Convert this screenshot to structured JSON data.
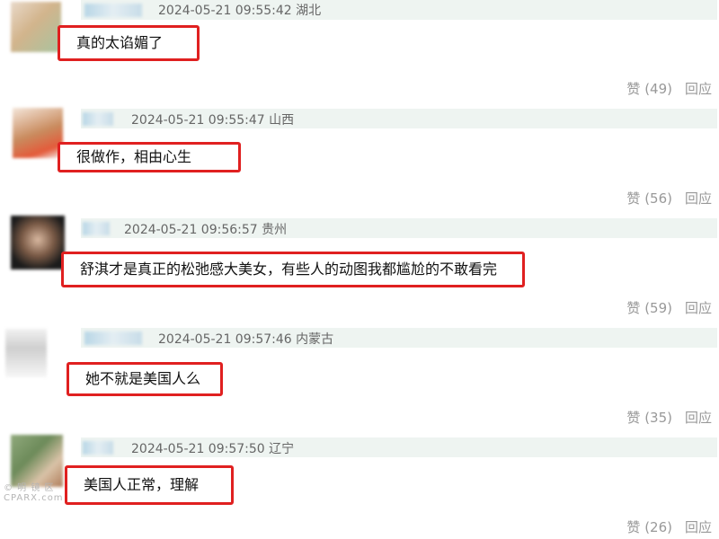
{
  "comments": [
    {
      "timestamp": "2024-05-21 09:55:42",
      "location": "湖北",
      "text": "真的太谄媚了",
      "likes_label": "赞",
      "likes_count": "(49)",
      "reply_label": "回应"
    },
    {
      "timestamp": "2024-05-21 09:55:47",
      "location": "山西",
      "text": "很做作，相由心生",
      "likes_label": "赞",
      "likes_count": "(56)",
      "reply_label": "回应"
    },
    {
      "timestamp": "2024-05-21 09:56:57",
      "location": "贵州",
      "text": "舒淇才是真正的松弛感大美女，有些人的动图我都尴尬的不敢看完",
      "likes_label": "赞",
      "likes_count": "(59)",
      "reply_label": "回应"
    },
    {
      "timestamp": "2024-05-21 09:57:46",
      "location": "内蒙古",
      "text": "她不就是美国人么",
      "likes_label": "赞",
      "likes_count": "(35)",
      "reply_label": "回应"
    },
    {
      "timestamp": "2024-05-21 09:57:50",
      "location": "辽宁",
      "text": "美国人正常，理解",
      "likes_label": "赞",
      "likes_count": "(26)",
      "reply_label": "回应"
    }
  ],
  "watermark": {
    "line1": "© 明 镜 区",
    "line2": "CPARX.com"
  },
  "colors": {
    "highlight_border": "#e02020",
    "meta_bar": "#eef4f1",
    "meta_text": "#666666",
    "action_text": "#999999"
  }
}
